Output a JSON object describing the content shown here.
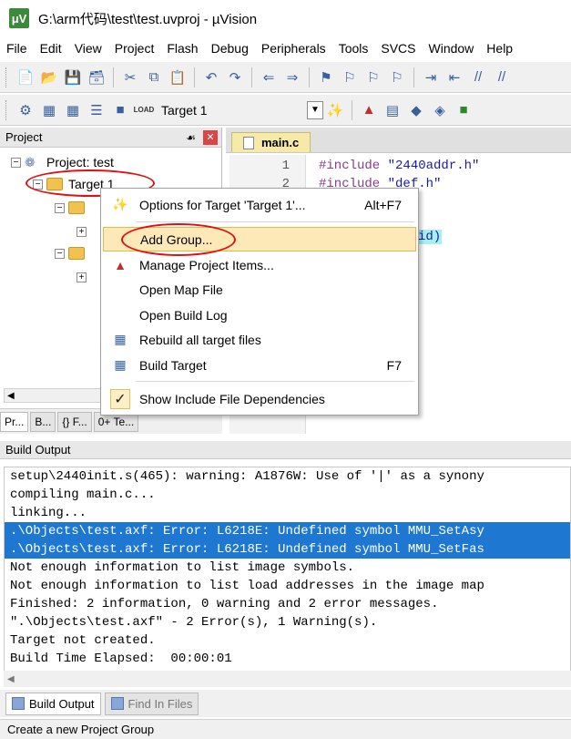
{
  "window": {
    "title": "G:\\arm代码\\test\\test.uvproj - µVision",
    "logo": "μV"
  },
  "menu": [
    "File",
    "Edit",
    "View",
    "Project",
    "Flash",
    "Debug",
    "Peripherals",
    "Tools",
    "SVCS",
    "Window",
    "Help"
  ],
  "toolbar2": {
    "target_value": "Target 1",
    "load_label": "LOAD"
  },
  "project_panel": {
    "title": "Project",
    "root": "Project: test",
    "target": "Target 1",
    "tabs": [
      "Pr...",
      "B...",
      "{} F...",
      "0+ Te..."
    ]
  },
  "editor": {
    "tab": "main.c",
    "lines": [
      {
        "n": "1",
        "code": "#include ",
        "str": "\"2440addr.h\""
      },
      {
        "n": "2",
        "code": "#include ",
        "str": "\"def.h\""
      }
    ],
    "partial_text": "id)"
  },
  "context_menu": {
    "items": [
      {
        "label": "Options for Target 'Target 1'...",
        "shortcut": "Alt+F7",
        "icon": "magic-wand-icon"
      },
      {
        "label": "Add Group...",
        "shortcut": "",
        "icon": ""
      },
      {
        "label": "Manage Project Items...",
        "shortcut": "",
        "icon": "manage-items-icon"
      },
      {
        "label": "Open Map File",
        "shortcut": "",
        "icon": ""
      },
      {
        "label": "Open Build Log",
        "shortcut": "",
        "icon": ""
      },
      {
        "label": "Rebuild all target files",
        "shortcut": "",
        "icon": "rebuild-icon"
      },
      {
        "label": "Build Target",
        "shortcut": "F7",
        "icon": "build-icon"
      },
      {
        "label": "Show Include File Dependencies",
        "shortcut": "",
        "icon": "checkmark-icon"
      }
    ]
  },
  "build_output": {
    "title": "Build Output",
    "lines": [
      "setup\\2440init.s(465): warning: A1876W: Use of '|' as a synony",
      "compiling main.c...",
      "linking...",
      ".\\Objects\\test.axf: Error: L6218E: Undefined symbol MMU_SetAsy",
      ".\\Objects\\test.axf: Error: L6218E: Undefined symbol MMU_SetFas",
      "Not enough information to list image symbols.",
      "Not enough information to list load addresses in the image map",
      "Finished: 2 information, 0 warning and 2 error messages.",
      "\".\\Objects\\test.axf\" - 2 Error(s), 1 Warning(s).",
      "Target not created.",
      "Build Time Elapsed:  00:00:01"
    ],
    "selected": [
      3,
      4
    ]
  },
  "bottom_tabs": [
    "Build Output",
    "Find In Files"
  ],
  "status": "Create a new Project Group",
  "colors": {
    "selection": "#1e78d2",
    "highlight": "#fde8b8",
    "annotation": "#e01010"
  }
}
